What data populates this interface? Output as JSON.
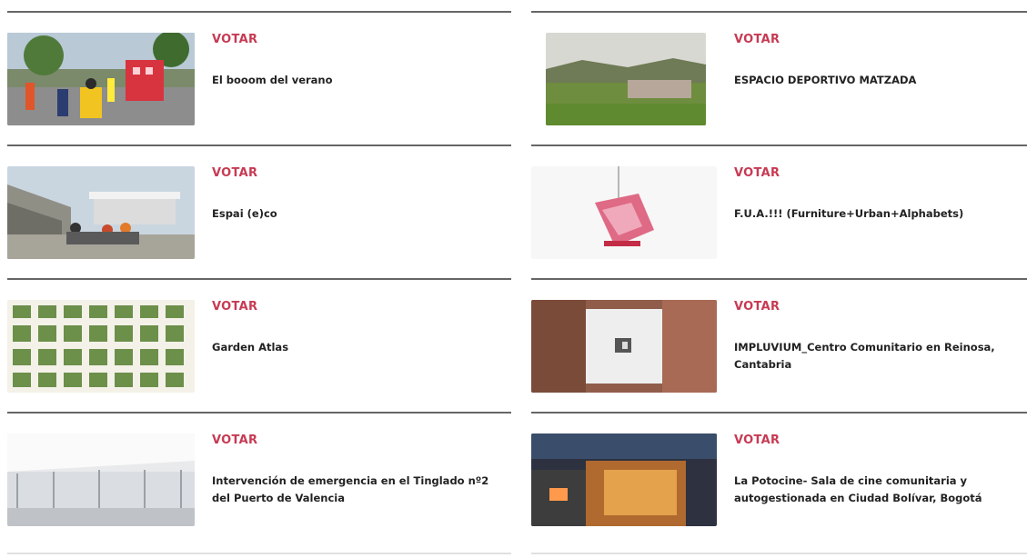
{
  "vote_label": "VOTAR",
  "accent_color": "#c73a53",
  "left_items": [
    {
      "title": "El booom del verano",
      "thumb": "street-festival-photo"
    },
    {
      "title": "Espai (e)co",
      "thumb": "tent-stone-wall-photo"
    },
    {
      "title": "Garden Atlas",
      "thumb": "botanical-grid-photo"
    },
    {
      "title": "Intervención de emergencia en el Tinglado nº2 del Puerto de Valencia",
      "thumb": "white-hall-interior-photo"
    }
  ],
  "right_items": [
    {
      "title": "ESPACIO DEPORTIVO MATZADA",
      "thumb": "valley-village-photo"
    },
    {
      "title": "F.U.A.!!! (Furniture+Urban+Alphabets)",
      "thumb": "pink-crate-installation-photo"
    },
    {
      "title": "IMPLUVIUM_Centro Comunitario en Reinosa, Cantabria",
      "thumb": "aerial-courtyard-photo"
    },
    {
      "title": "La Potocine- Sala de cine comunitaria y autogestionada en Ciudad Bolívar, Bogotá",
      "thumb": "night-wood-building-photo"
    }
  ]
}
